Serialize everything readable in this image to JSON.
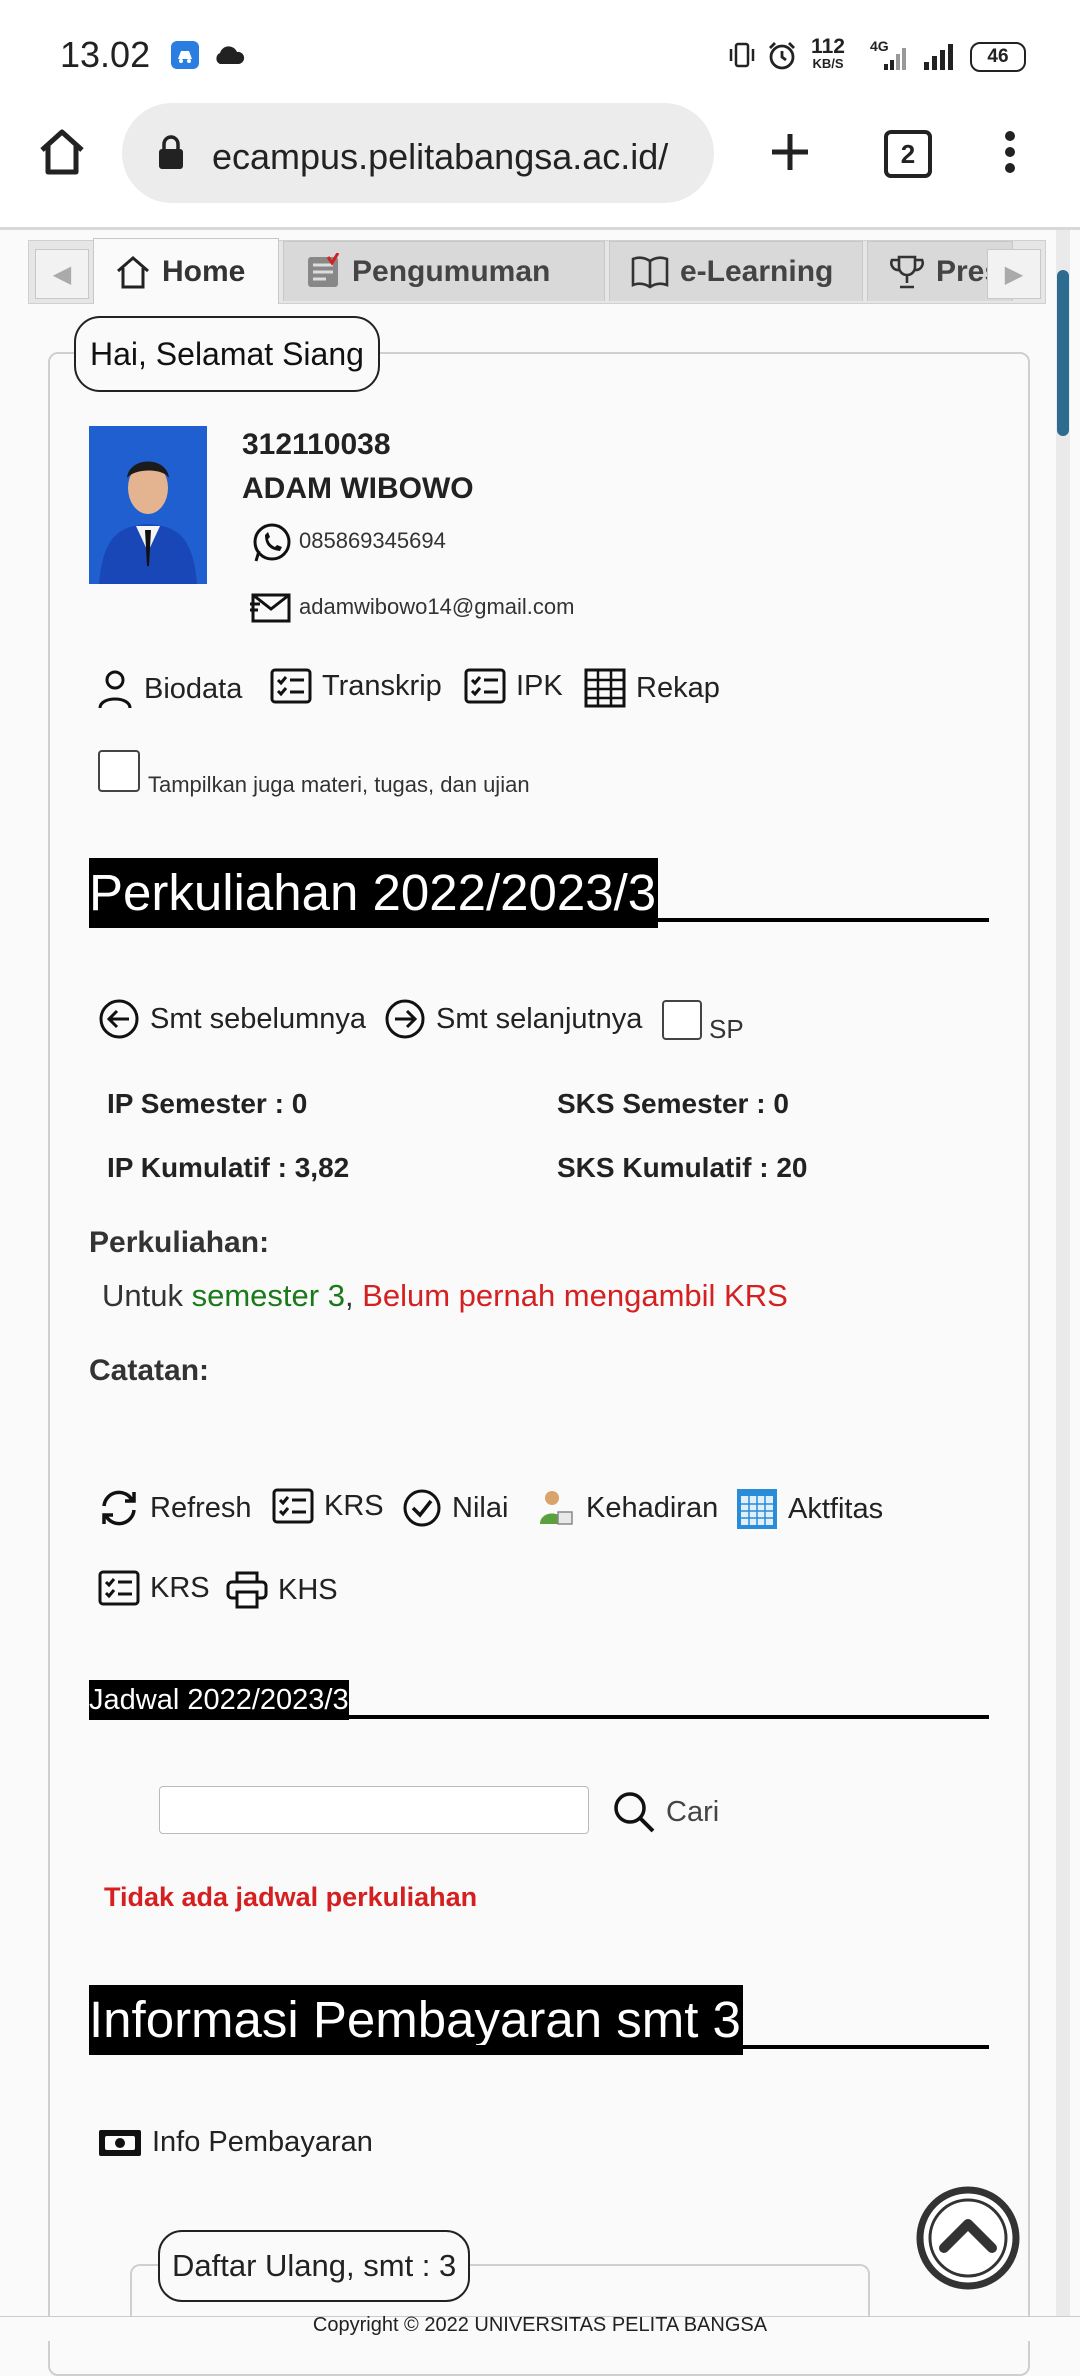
{
  "status_bar": {
    "time": "13.02",
    "net_speed_value": "112",
    "net_speed_unit": "KB/S",
    "network_type": "4G",
    "battery": "46"
  },
  "browser": {
    "url": "ecampus.pelitabangsa.ac.id/",
    "tab_count": "2"
  },
  "tabs": [
    {
      "label": "Home",
      "icon": "home-icon",
      "active": true
    },
    {
      "label": "Pengumuman",
      "icon": "announcement-icon",
      "active": false
    },
    {
      "label": "e-Learning",
      "icon": "book-icon",
      "active": false
    },
    {
      "label": "Prest",
      "icon": "trophy-icon",
      "active": false
    }
  ],
  "profile": {
    "greeting": "Hai, Selamat Siang",
    "nim": "312110038",
    "name": "ADAM WIBOWO",
    "phone": "085869345694",
    "email": "adamwibowo14@gmail.com"
  },
  "profile_links": {
    "biodata": "Biodata",
    "transkrip": "Transkrip",
    "ipk": "IPK",
    "rekap": "Rekap"
  },
  "show_materials_checkbox": {
    "label": "Tampilkan juga materi, tugas, dan ujian",
    "checked": false
  },
  "perkuliahan_section": {
    "title": "Perkuliahan 2022/2023/3",
    "prev_semester": "Smt sebelumnya",
    "next_semester": "Smt selanjutnya",
    "sp_label": "SP",
    "ip_semester": "IP Semester : 0",
    "sks_semester": "SKS Semester : 0",
    "ip_kumulatif": "IP Kumulatif : 3,82",
    "sks_kumulatif": "SKS Kumulatif : 20",
    "perkuliahan_label": "Perkuliahan:",
    "notice_prefix": "Untuk ",
    "notice_semester": "semester 3",
    "notice_sep": ", ",
    "notice_status": "Belum pernah mengambil KRS",
    "catatan_label": "Catatan:",
    "actions": {
      "refresh": "Refresh",
      "krs": "KRS",
      "nilai": "Nilai",
      "kehadiran": "Kehadiran",
      "aktfitas": "Aktfitas",
      "krs2": "KRS",
      "khs": "KHS"
    }
  },
  "jadwal_section": {
    "title": "Jadwal 2022/2023/3",
    "search_placeholder": "",
    "search_button": "Cari",
    "empty_message": "Tidak ada jadwal perkuliahan"
  },
  "pembayaran_section": {
    "title": "Informasi Pembayaran smt 3",
    "info_link": "Info Pembayaran",
    "daftar_ulang": "Daftar Ulang, smt : 3"
  },
  "footer": {
    "copyright": "Copyright © 2022 UNIVERSITAS PELITA BANGSA"
  },
  "colors": {
    "green_text": "#1a7a1a",
    "red_text": "#d42020",
    "section_title_bg": "#000000",
    "photo_blue": "#1f5fd0"
  }
}
